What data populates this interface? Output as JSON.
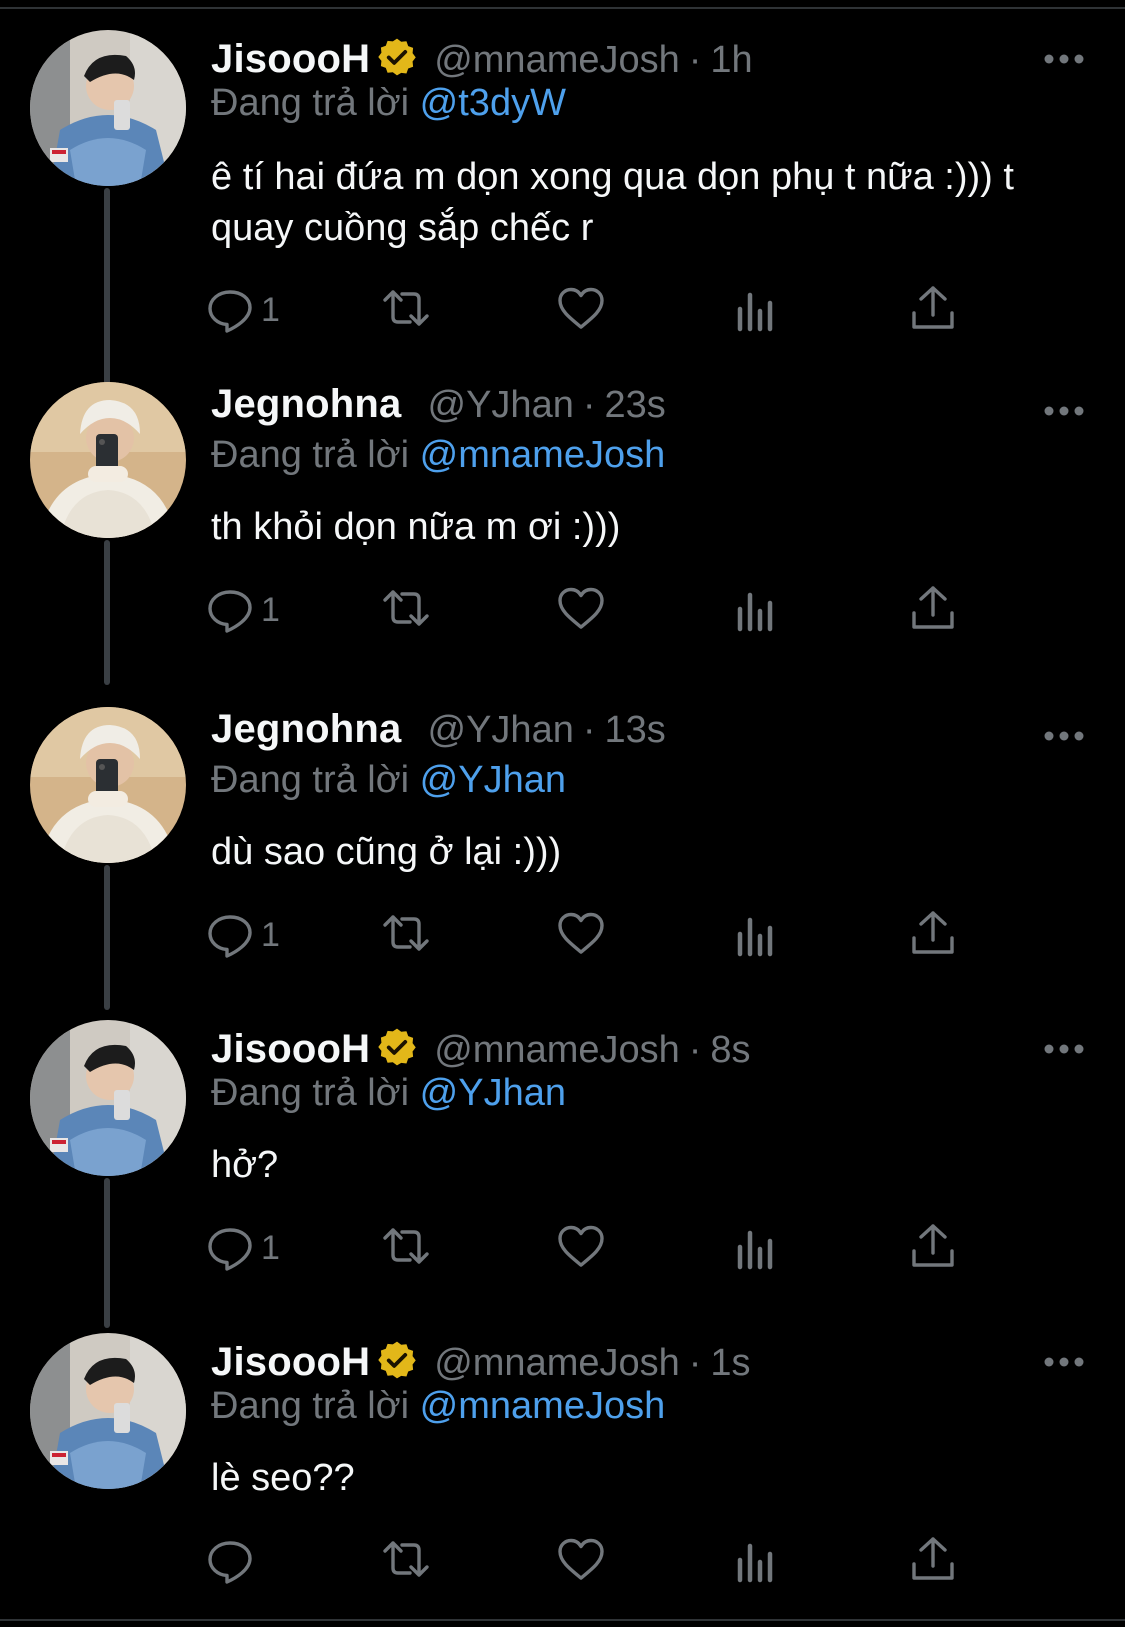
{
  "tweets": [
    {
      "name": "JisoooH",
      "verified": true,
      "handle": "@mnameJosh",
      "separator": "·",
      "time": "1h",
      "reply_prefix": "Đang trả lời",
      "reply_to": "@t3dyW",
      "text": "ê tí hai đứa m dọn xong qua dọn phụ t nữa :))) t quay cuồng sắp chếc r",
      "reply_count": "1",
      "avatar": "josh-avatar"
    },
    {
      "name": "Jegnohna",
      "verified": false,
      "handle": "@YJhan",
      "separator": "·",
      "time": "23s",
      "reply_prefix": "Đang trả lời",
      "reply_to": "@mnameJosh",
      "text": "th khỏi dọn nữa m ơi :)))",
      "reply_count": "1",
      "avatar": "jhan-avatar"
    },
    {
      "name": "Jegnohna",
      "verified": false,
      "handle": "@YJhan",
      "separator": "·",
      "time": "13s",
      "reply_prefix": "Đang trả lời",
      "reply_to": "@YJhan",
      "text": "dù sao cũng ở lại :)))",
      "reply_count": "1",
      "avatar": "jhan-avatar"
    },
    {
      "name": "JisoooH",
      "verified": true,
      "handle": "@mnameJosh",
      "separator": "·",
      "time": "8s",
      "reply_prefix": "Đang trả lời",
      "reply_to": "@YJhan",
      "text": "hở?",
      "reply_count": "1",
      "avatar": "josh-avatar"
    },
    {
      "name": "JisoooH",
      "verified": true,
      "handle": "@mnameJosh",
      "separator": "·",
      "time": "1s",
      "reply_prefix": "Đang trả lời",
      "reply_to": "@mnameJosh",
      "text": "lè seo??",
      "reply_count": "",
      "avatar": "josh-avatar"
    }
  ],
  "icons": [
    "reply-icon",
    "retweet-icon",
    "like-icon",
    "views-icon",
    "share-icon",
    "more-icon",
    "verified-badge-icon"
  ],
  "colors": {
    "background": "#000000",
    "text": "#f5f7f8",
    "muted": "#72777c",
    "mention": "#4ea0ec",
    "verified": "#e2b719",
    "thread_line": "#3a3f44"
  }
}
